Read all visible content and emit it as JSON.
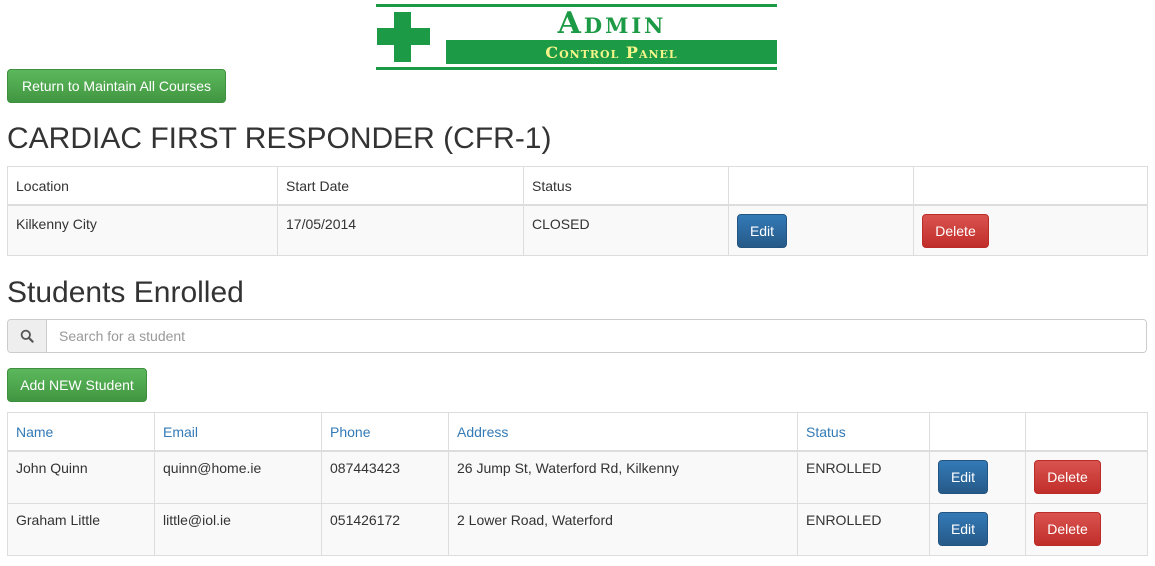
{
  "logo": {
    "title": "Admin",
    "subtitle": "Control Panel",
    "color": "#1c9a45",
    "subtitle_color": "#f5f58a"
  },
  "actions": {
    "return_label": "Return to Maintain All Courses",
    "add_student_label": "Add NEW Student"
  },
  "course": {
    "title": "CARDIAC FIRST RESPONDER (CFR-1)",
    "columns": [
      "Location",
      "Start Date",
      "Status",
      "",
      ""
    ],
    "row": {
      "location": "Kilkenny City",
      "start_date": "17/05/2014",
      "status": "CLOSED",
      "edit_label": "Edit",
      "delete_label": "Delete"
    }
  },
  "students": {
    "title": "Students Enrolled",
    "search_placeholder": "Search for a student",
    "search_icon": "search-icon",
    "columns": [
      "Name",
      "Email",
      "Phone",
      "Address",
      "Status",
      "",
      ""
    ],
    "rows": [
      {
        "name": "John Quinn",
        "email": "quinn@home.ie",
        "phone": "087443423",
        "address": "26 Jump St, Waterford Rd, Kilkenny",
        "status": "ENROLLED",
        "edit_label": "Edit",
        "delete_label": "Delete"
      },
      {
        "name": "Graham Little",
        "email": "little@iol.ie",
        "phone": "051426172",
        "address": "2 Lower Road, Waterford",
        "status": "ENROLLED",
        "edit_label": "Edit",
        "delete_label": "Delete"
      }
    ]
  },
  "colors": {
    "success": "#5cb85c",
    "primary": "#337ab7",
    "danger": "#d9534f",
    "link": "#337ab7"
  }
}
